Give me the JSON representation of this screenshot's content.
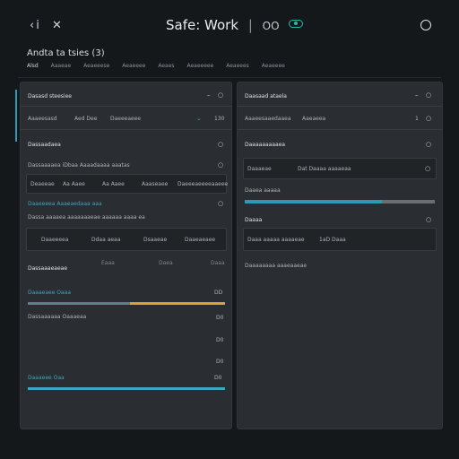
{
  "header": {
    "nav_back": "‹i",
    "nav_close": "✕",
    "app_title": "Safe: Work",
    "separator": "|",
    "status_text": "OO",
    "subtitle": "Andta ta tsies  (3)",
    "tabs": [
      "Alsd",
      "Aaaeae",
      "Aeaeeese",
      "Aeaeeee",
      "Aeaes",
      "Aeaeeeee",
      "Aeaeees",
      "Aeaeeee"
    ]
  },
  "left": {
    "section1": {
      "title": "Dasasd steesiee",
      "icon": "–"
    },
    "row1": {
      "col1": "Aaaeesasd",
      "col2": "Aed Dee",
      "col3": "Daeeeaeee",
      "value": "130"
    },
    "section2": {
      "title": "Dassaadaea"
    },
    "row2": {
      "label": "Dassaaaaea iDbaa Aaaadaaaa aaatas"
    },
    "table1": {
      "cells": [
        "Deaeeae",
        "Aa Aaee",
        "Aa Aaee",
        "Aaaseaee",
        "Daeeeaeeeeaaeee"
      ]
    },
    "section3": {
      "title": "Daaeeeea Aaaeaedaaa aaa"
    },
    "row3": {
      "label": "Dassa aaaaea aaaaaaaeae aaaaaa aaaa ea"
    },
    "table2": {
      "cells": [
        "Daaeeeea",
        "Ddaa aeaa",
        "Dsaaeae",
        "Daaeaeaee"
      ]
    },
    "section4": {
      "title": "Dassaaaeaeae",
      "v1": "Eaaa",
      "v2": "Daea",
      "v3": "Daaa"
    },
    "progress1": {
      "label": "Daaaeaee Oaaa",
      "value": "DD",
      "fraction": 0.52
    },
    "row4": {
      "label": "Dassaaaaaa Oaaaeaa",
      "value": "D0"
    },
    "row5": {
      "value": "D0"
    },
    "row6": {
      "value": "D0"
    },
    "progress2": {
      "label": "Daaaeee Oaa",
      "value": "D0",
      "fraction": 1.0
    }
  },
  "right": {
    "section1": {
      "title": "Daasaad ataela",
      "icon": "–"
    },
    "row1": {
      "col1": "Aaaeesaaedaaea",
      "col2": "Aaeaeea",
      "value": "1"
    },
    "section2": {
      "title": "Daaaaaaaaaea"
    },
    "row2": {
      "col1": "Daaaeae",
      "col2": "Dat Daaaa aaaaeaa"
    },
    "section3": {
      "title": "Daaea aaaaa"
    },
    "progress1": {
      "fraction": 0.72
    },
    "section4": {
      "title": "Daaaa"
    },
    "row3": {
      "col1": "Daaa aaaaa aaaaeae",
      "col2": "1aD Daaa"
    },
    "row4": {
      "label": "Daaaaaaaa aaaeaaeae"
    }
  },
  "colors": {
    "accent": "#2d9ab4",
    "teal": "#2bb7b0",
    "amber": "#d9a234",
    "panel": "#2a2d31",
    "bg": "#15181b"
  }
}
